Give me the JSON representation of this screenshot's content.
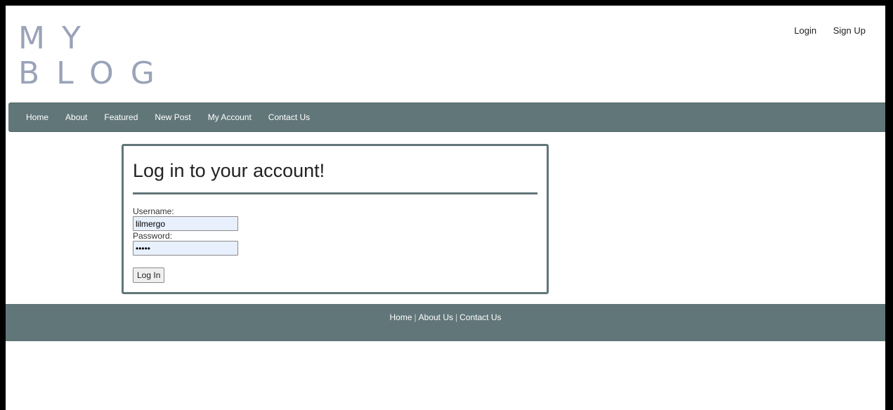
{
  "logo": {
    "line1": "MY",
    "line2": "BLOG"
  },
  "header_links": {
    "login": "Login",
    "signup": "Sign Up"
  },
  "nav": [
    "Home",
    "About",
    "Featured",
    "New Post",
    "My Account",
    "Contact Us"
  ],
  "login_card": {
    "title": "Log in to your account!",
    "username_label": "Username:",
    "username_value": "lilmergo",
    "password_label": "Password:",
    "password_value": "•••••",
    "submit_label": "Log In"
  },
  "footer": {
    "home": "Home",
    "about": "About Us",
    "contact": "Contact Us",
    "separator": "|"
  },
  "colors": {
    "accent": "#617679",
    "logo": "#9aa3b8"
  }
}
